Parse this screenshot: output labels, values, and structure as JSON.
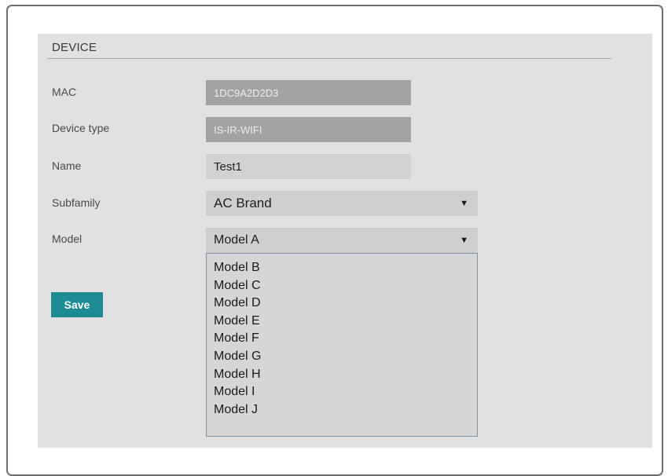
{
  "section": {
    "title": "DEVICE"
  },
  "fields": {
    "mac": {
      "label": "MAC",
      "value": "1DC9A2D2D3"
    },
    "device_type": {
      "label": "Device type",
      "value": "IS-IR-WIFI"
    },
    "name": {
      "label": "Name",
      "value": "Test1"
    },
    "subfamily": {
      "label": "Subfamily",
      "value": "AC Brand"
    },
    "model": {
      "label": "Model",
      "value": "Model A"
    }
  },
  "model_options": [
    "Model B",
    "Model C",
    "Model D",
    "Model E",
    "Model F",
    "Model G",
    "Model H",
    "Model I",
    "Model J"
  ],
  "actions": {
    "save_label": "Save"
  },
  "icons": {
    "dropdown_arrow": "▼"
  },
  "colors": {
    "panel_background": "#e1e1e1",
    "save_button": "#1d8c95",
    "readonly_field": "#a3a3a3",
    "editable_field": "#d2d2d2"
  }
}
